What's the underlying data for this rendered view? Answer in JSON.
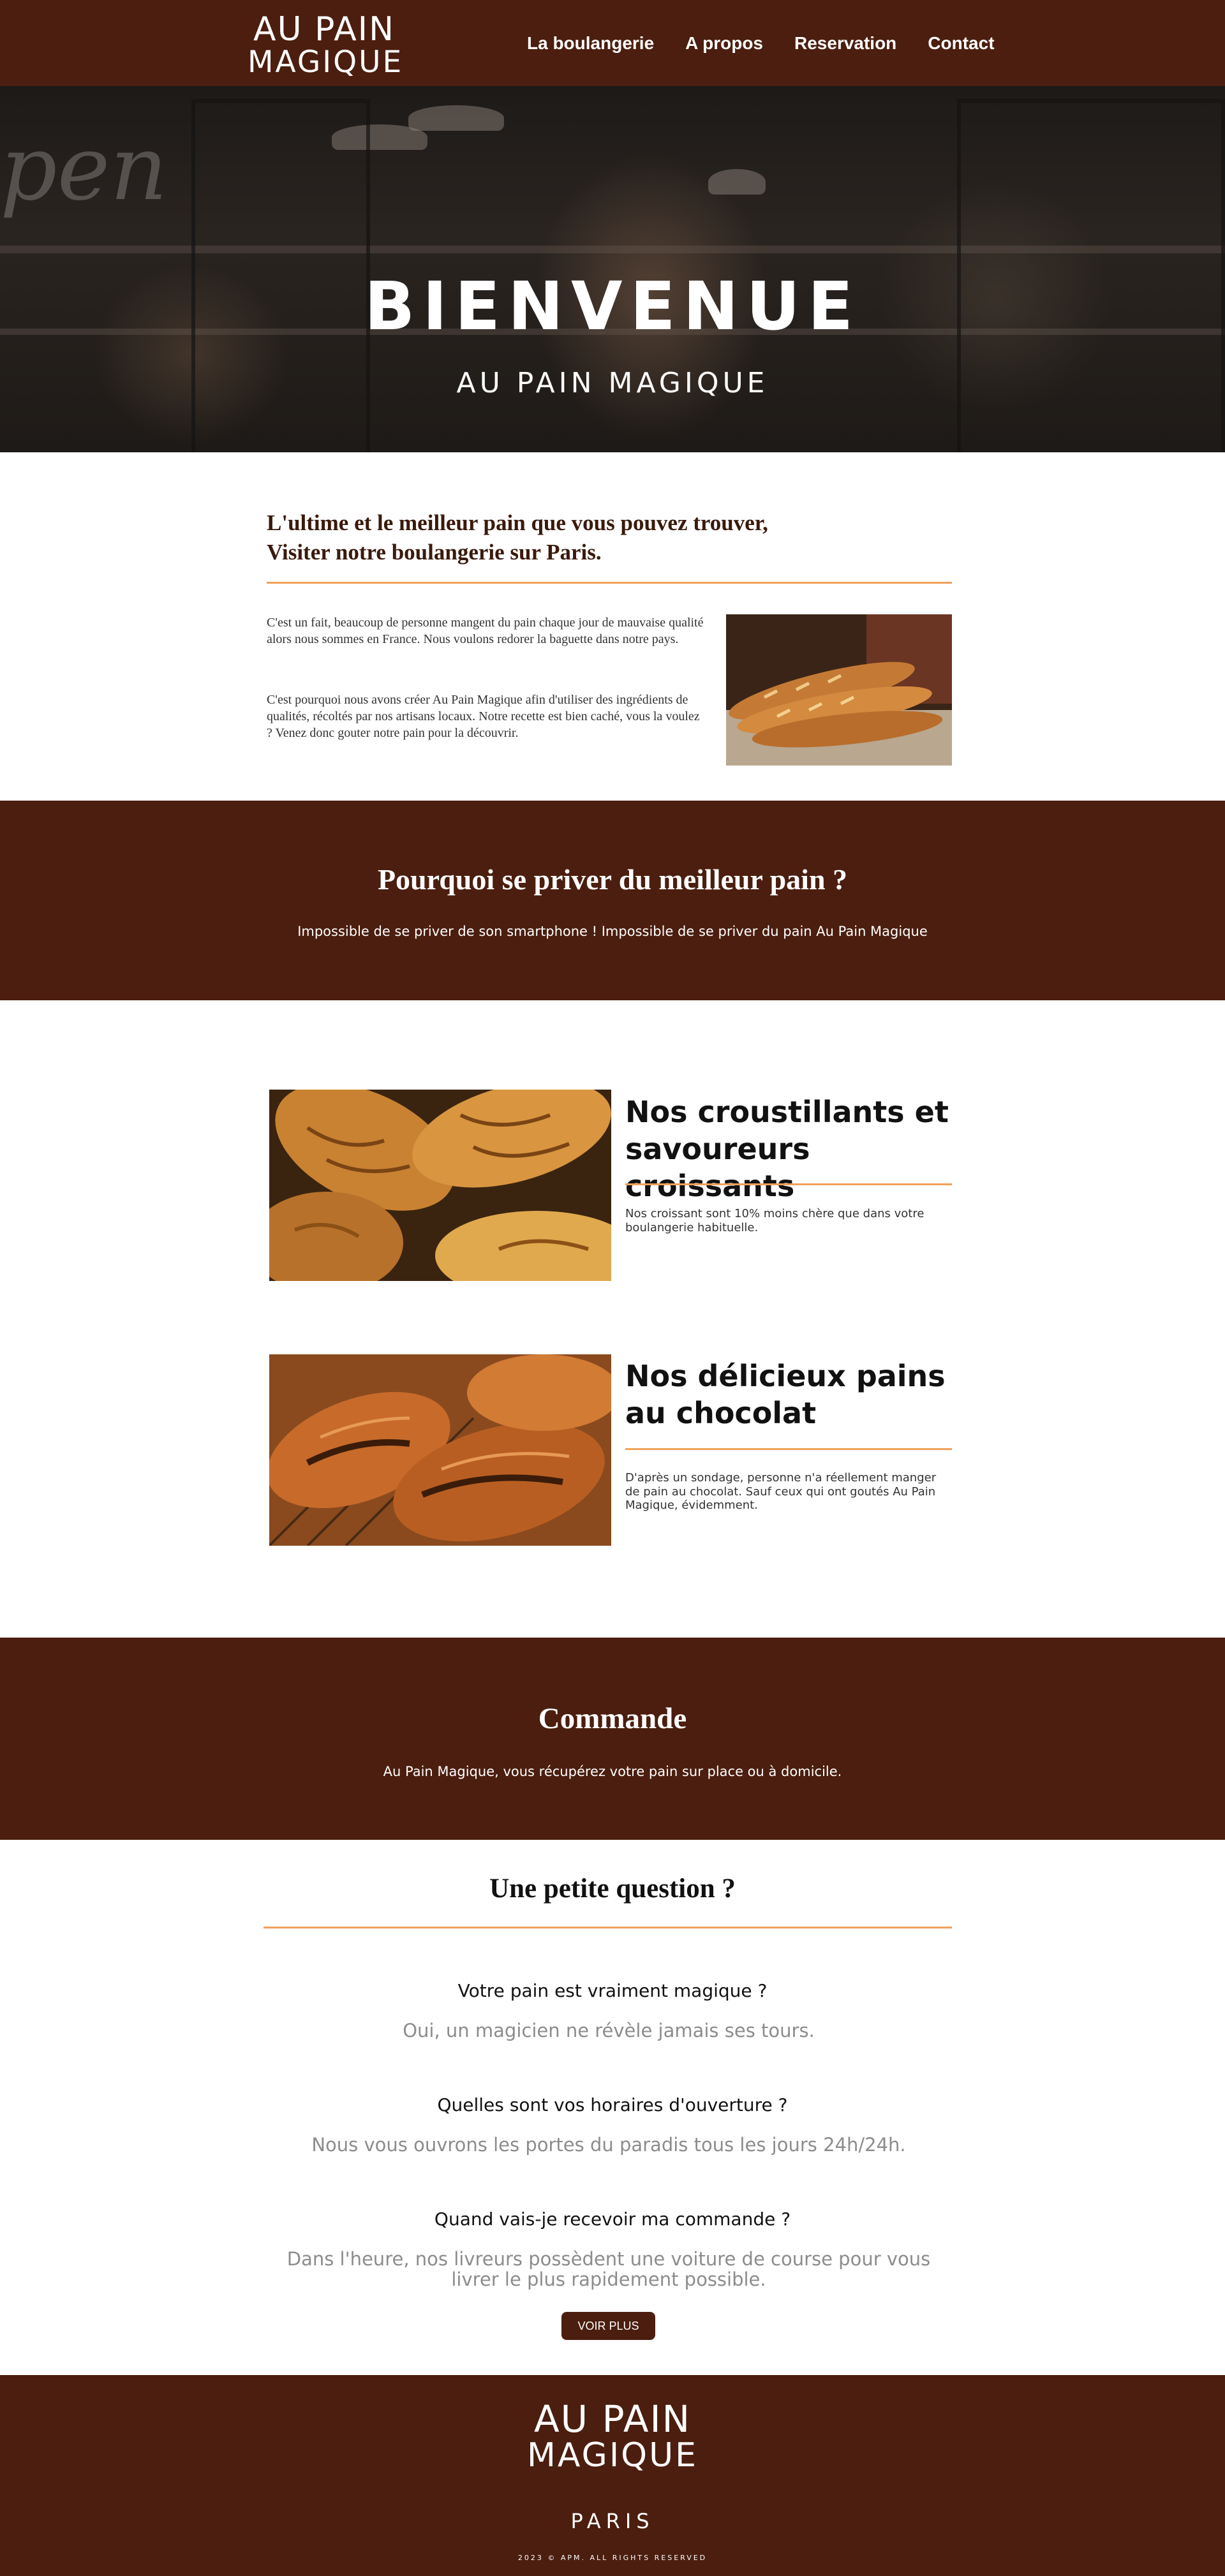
{
  "nav": {
    "logo_line1": "AU PAIN",
    "logo_line2": "MAGIQUE",
    "items": [
      "La boulangerie",
      "A propos",
      "Reservation",
      "Contact"
    ]
  },
  "hero": {
    "title": "BIENVENUE",
    "subtitle": "AU PAIN MAGIQUE"
  },
  "intro": {
    "heading_line1": "L'ultime et le meilleur pain que vous pouvez trouver,",
    "heading_line2": "Visiter notre boulangerie sur Paris.",
    "paragraph1": "C'est un fait, beaucoup de personne mangent du pain chaque jour de mauvaise qualité alors nous sommes en France. Nous voulons redorer la baguette dans notre pays.",
    "paragraph2": "C'est pourquoi nous avons créer Au Pain Magique afin d'utiliser des ingrédients de qualités, récoltés par nos artisans locaux. Notre recette est bien caché, vous la voulez ? Venez donc gouter notre pain pour la découvrir."
  },
  "why": {
    "title": "Pourquoi se priver du meilleur pain ?",
    "text": "Impossible de se priver de son smartphone ! Impossible de se priver du pain Au Pain Magique"
  },
  "products": [
    {
      "title_line1": "Nos croustillants et",
      "title_line2": "savoureurs croissants",
      "text": "Nos croissant sont 10% moins chère que dans votre boulangerie habituelle."
    },
    {
      "title_line1": "Nos délicieux pains",
      "title_line2": "au chocolat",
      "text": "D'après un sondage, personne n'a réellement manger de pain au chocolat. Sauf ceux qui ont goutés Au Pain Magique, évidemment."
    }
  ],
  "order": {
    "title": "Commande",
    "text": "Au Pain Magique, vous récupérez votre pain sur place ou à domicile."
  },
  "faq": {
    "title": "Une petite question ?",
    "items": [
      {
        "q": "Votre pain est vraiment magique ?",
        "a": "Oui, un magicien ne révèle jamais ses tours."
      },
      {
        "q": "Quelles sont vos horaires d'ouverture ?",
        "a": "Nous vous ouvrons les portes du paradis tous les jours 24h/24h."
      },
      {
        "q": "Quand vais-je recevoir ma commande ?",
        "a": "Dans l'heure, nos livreurs possèdent une voiture de course pour vous livrer le plus rapidement possible."
      }
    ],
    "button_label": "VOIR PLUS"
  },
  "footer": {
    "logo_line1": "AU PAIN",
    "logo_line2": "MAGIQUE",
    "city": "PARIS",
    "copyright": "2023 © APM. ALL RIGHTS RESERVED"
  },
  "colors": {
    "brand_brown": "#4b1e0f",
    "accent_orange": "#f0a05a",
    "answer_gray": "#8c8c8c"
  }
}
